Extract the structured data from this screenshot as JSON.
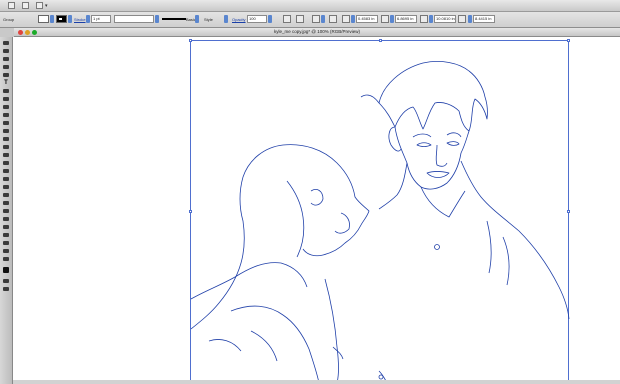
{
  "control_bar": {
    "object_label": "Group",
    "stroke_label": "Stroke",
    "stroke_weight": "1 pt",
    "brush_label": "Basic",
    "style_label": "Style",
    "opacity_label": "Opacity",
    "opacity_value": "100",
    "x_value": "0.4583 in",
    "y_value": "6.8695 in",
    "w_value": "10.0810 in",
    "h_value": "8.4415 in"
  },
  "document": {
    "title": "kyle_me copy.jpg* @ 100% (RGB/Preview)"
  },
  "artwork": {
    "stroke_color": "#1f3fa8",
    "selection_color": "#4f6fcf"
  },
  "colors": {
    "close": "#e0443e",
    "minimize": "#dea123",
    "zoom": "#1aab29"
  }
}
